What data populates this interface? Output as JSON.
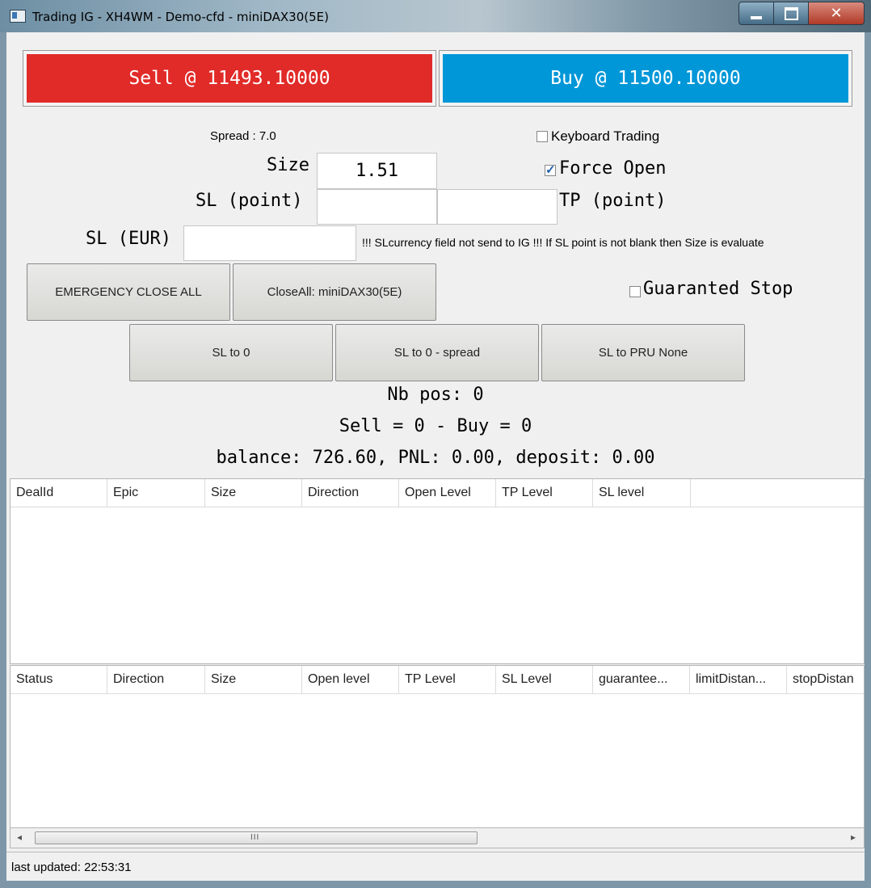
{
  "window": {
    "title": "Trading IG - XH4WM - Demo-cfd - miniDAX30(5E)",
    "min_glyph": "",
    "close_glyph": "✕"
  },
  "trade": {
    "sell_label": "Sell @ 11493.10000",
    "buy_label": "Buy @ 11500.10000",
    "sell_color": "#e12b28",
    "buy_color": "#0097d8"
  },
  "form": {
    "spread": "Spread : 7.0",
    "keyboard_trading": "Keyboard Trading",
    "keyboard_trading_checked": false,
    "size_label": "Size",
    "size_value": "1.51",
    "force_open": "Force Open",
    "force_open_checked": true,
    "sl_point_label": "SL (point)",
    "sl_point_value": "",
    "tp_point_value": "",
    "tp_point_label": "TP (point)",
    "sl_eur_label": "SL (EUR)",
    "sl_eur_value": "",
    "sl_currency_note": "!!! SLcurrency field not send to IG !!! If SL point is not blank then Size is evaluate",
    "guaranteed_stop": "Guaranted Stop",
    "guaranteed_stop_checked": false
  },
  "actions": {
    "emergency_close_all": "EMERGENCY CLOSE ALL",
    "close_all": "CloseAll: miniDAX30(5E)",
    "sl_to_0": "SL to 0",
    "sl_to_0_spread": "SL to 0 - spread",
    "sl_to_pru": "SL to PRU None"
  },
  "summary": {
    "nb_pos": "Nb pos: 0",
    "sell_buy": "Sell = 0 - Buy = 0",
    "balance": "balance: 726.60, PNL: 0.00, deposit: 0.00"
  },
  "positions_table": {
    "columns": [
      "DealId",
      "Epic",
      "Size",
      "Direction",
      "Open Level",
      "TP Level",
      "SL level"
    ],
    "rows": []
  },
  "orders_table": {
    "columns": [
      "Status",
      "Direction",
      "Size",
      "Open level",
      "TP Level",
      "SL Level",
      "guarantee...",
      "limitDistan...",
      "stopDistan"
    ],
    "rows": []
  },
  "scrollbar": {
    "left_arrow": "◂",
    "right_arrow": "▸",
    "grip": "III"
  },
  "status": {
    "last_updated": "last updated: 22:53:31"
  }
}
